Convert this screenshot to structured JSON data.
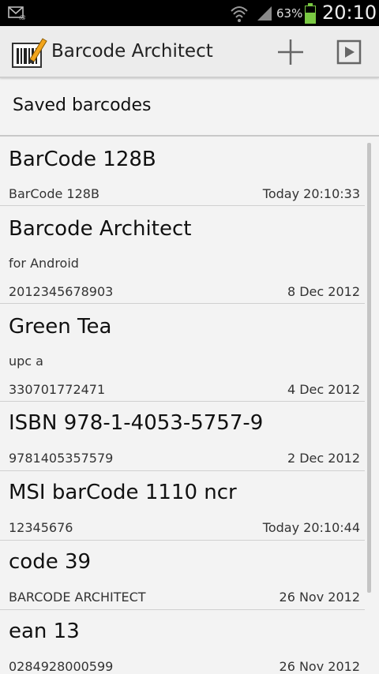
{
  "status_bar": {
    "battery_percent": "63%",
    "time": "20:10",
    "icons": [
      "mail-icon",
      "wifi-icon",
      "signal-icon",
      "battery-icon"
    ]
  },
  "action_bar": {
    "title": "Barcode Architect",
    "icons": [
      "barcode-app-icon",
      "add-icon",
      "play-icon"
    ]
  },
  "section": {
    "title": "Saved barcodes"
  },
  "items": [
    {
      "title": "BarCode 128B",
      "description": "",
      "code": "BarCode 128B",
      "date": "Today 20:10:33"
    },
    {
      "title": "Barcode Architect",
      "description": "for Android",
      "code": "2012345678903",
      "date": "8 Dec 2012"
    },
    {
      "title": "Green Tea",
      "description": "upc a",
      "code": "330701772471",
      "date": "4 Dec 2012"
    },
    {
      "title": "ISBN 978-1-4053-5757-9",
      "description": "",
      "code": "9781405357579",
      "date": "2 Dec 2012"
    },
    {
      "title": "MSI barCode 1110 ncr",
      "description": "",
      "code": "12345676",
      "date": "Today 20:10:44"
    },
    {
      "title": "code 39",
      "description": "",
      "code": "BARCODE ARCHITECT",
      "date": "26 Nov 2012"
    },
    {
      "title": "ean 13",
      "description": "",
      "code": "0284928000599",
      "date": "26 Nov 2012"
    }
  ],
  "colors": {
    "battery_green": "#7ac943",
    "action_bar_bg": "#ececec",
    "list_bg": "#f3f3f3"
  }
}
